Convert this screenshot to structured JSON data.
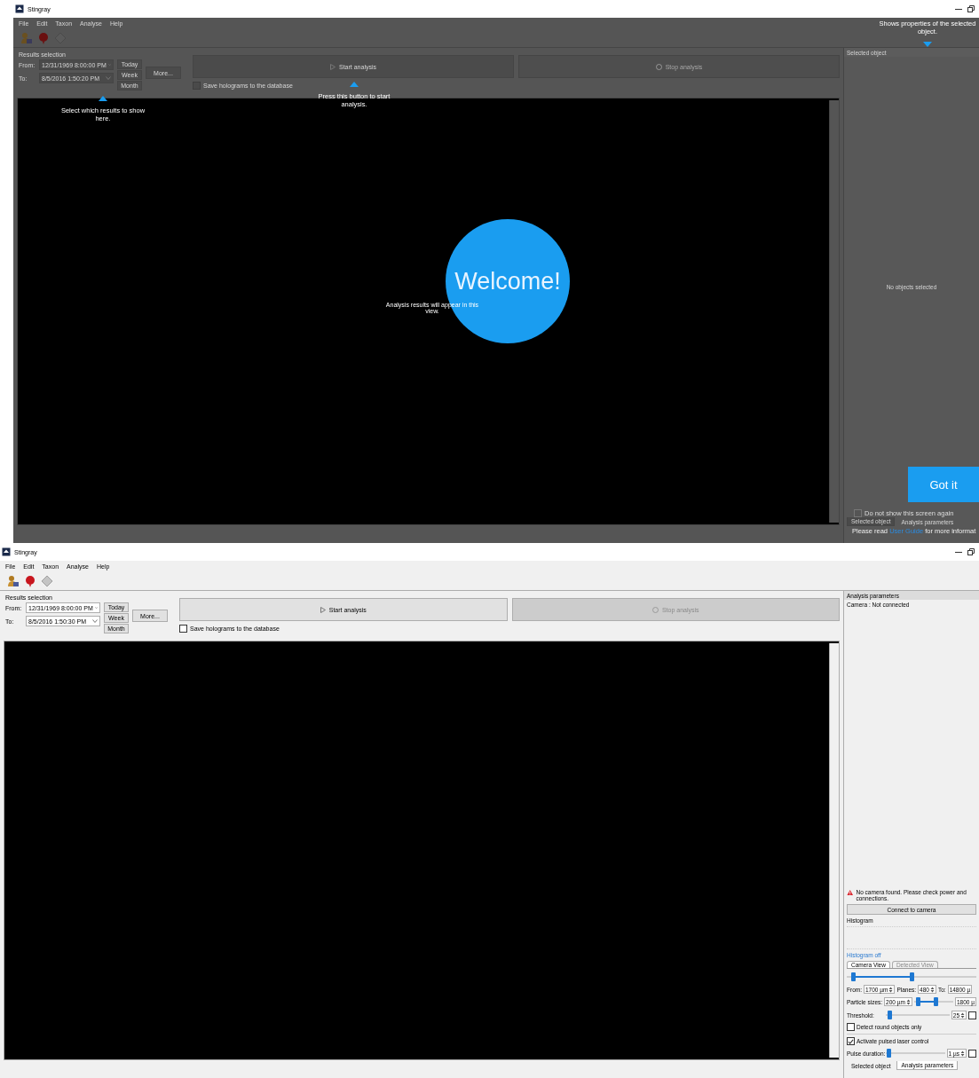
{
  "screens": [
    {
      "dimmed": true,
      "title": "Stingray",
      "menu": [
        "File",
        "Edit",
        "Taxon",
        "Analyse",
        "Help"
      ],
      "results_selection": {
        "title": "Results selection",
        "from_label": "From:",
        "from_value": "12/31/1969 8:00:00 PM",
        "to_label": "To:",
        "to_value": "8/5/2016 1:50:20 PM",
        "range_buttons": [
          "Today",
          "Week",
          "Month"
        ],
        "more_button": "More..."
      },
      "start_button": "Start analysis",
      "stop_button": {
        "label": "Stop analysis",
        "disabled": true
      },
      "save_checkbox": {
        "label": "Save holograms to the database",
        "checked": false
      },
      "side_panel": {
        "kind": "selected_object",
        "header": "Selected object",
        "empty_text": "No objects selected",
        "tabs": [
          {
            "label": "Selected object",
            "selected": true
          },
          {
            "label": "Analysis parameters",
            "selected": false
          }
        ]
      },
      "tour": {
        "callouts": [
          {
            "text": "Select which results to show here."
          },
          {
            "text": "Press this button to start analysis."
          },
          {
            "text": "Shows properties of the selected object."
          }
        ],
        "welcome": "Welcome!",
        "view_hint": "Analysis results will appear in this view.",
        "got_it": "Got it",
        "dont_show": {
          "label": "Do not show this screen again",
          "checked": false
        },
        "footer": {
          "before": "Please read",
          "link": "User Guide",
          "after": "for more informat"
        }
      }
    },
    {
      "dimmed": false,
      "title": "Stingray",
      "menu": [
        "File",
        "Edit",
        "Taxon",
        "Analyse",
        "Help"
      ],
      "results_selection": {
        "title": "Results selection",
        "from_label": "From:",
        "from_value": "12/31/1969 8:00:00 PM",
        "to_label": "To:",
        "to_value": "8/5/2016 1:50:30 PM",
        "range_buttons": [
          "Today",
          "Week",
          "Month"
        ],
        "more_button": "More..."
      },
      "start_button": "Start analysis",
      "stop_button": {
        "label": "Stop analysis",
        "disabled": true
      },
      "save_checkbox": {
        "label": "Save holograms to the database",
        "checked": false
      },
      "side_panel": {
        "kind": "analysis_parameters",
        "header": "Analysis parameters",
        "camera_status": "Camera : Not connected",
        "warning": "No camera found. Please check power and connections.",
        "connect_button": "Connect to camera",
        "histogram_label": "Histogram",
        "histogram_toggle": "Histogram off",
        "view_tabs": [
          {
            "label": "Camera View",
            "selected": true
          },
          {
            "label": "Detected View",
            "selected": false
          }
        ],
        "planes_slider": {
          "thumbs": [
            {
              "level": 0.05
            },
            {
              "level": 0.5
            }
          ]
        },
        "from_label": "From:",
        "from_value": "1700 µm",
        "planes_label": "Planes:",
        "planes_value": "480",
        "to_label": "To:",
        "to_value": "14800 µ",
        "particle": {
          "label": "Particle sizes:",
          "min_value": "200 µm",
          "thumbs": [
            {
              "level": 0.1
            },
            {
              "level": 0.55
            }
          ],
          "max_value": "1800 µ"
        },
        "threshold": {
          "label": "Threshold:",
          "level": 0.05,
          "value": "25",
          "checked": false
        },
        "detect_round": {
          "label": "Detect round objects only",
          "checked": false
        },
        "pulsed_laser": {
          "label": "Activate pulsed laser control",
          "checked": true
        },
        "pulse_duration": {
          "label": "Pulse duration:",
          "level": 0.05,
          "value": "1 µs",
          "checked": false
        },
        "tabs": [
          {
            "label": "Selected object",
            "selected": false
          },
          {
            "label": "Analysis parameters",
            "selected": true
          }
        ]
      }
    }
  ]
}
